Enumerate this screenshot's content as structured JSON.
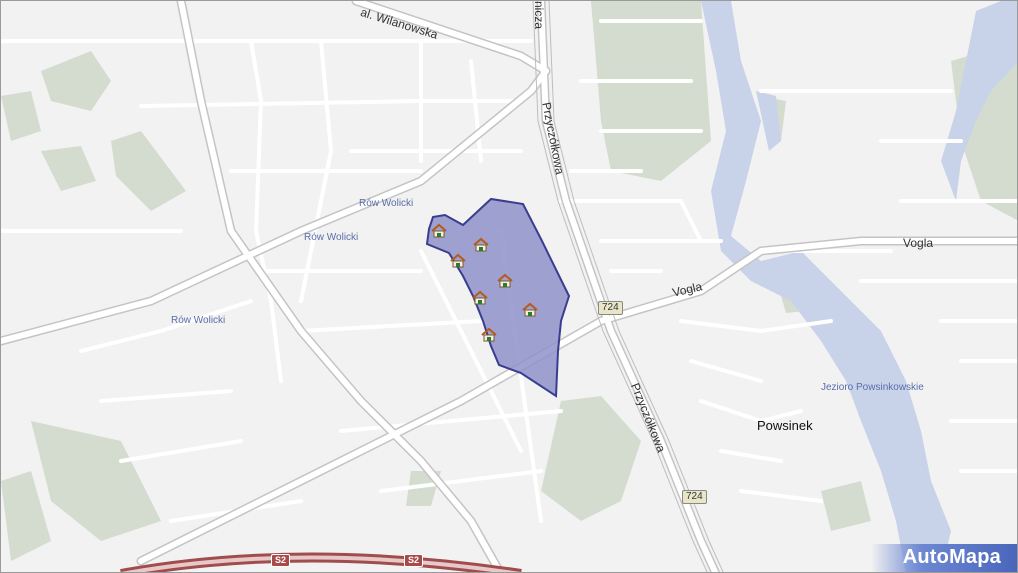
{
  "labels": {
    "wilanowska": "al. Wilanowska",
    "nicza": "nicza",
    "przyczolkowa_north": "Przyczółkowa",
    "przyczolkowa_south": "Przyczółkowa",
    "vogla_east": "Vogla",
    "vogla_mid": "Vogla",
    "row_wolicki_1": "Rów Wolicki",
    "row_wolicki_2": "Rów Wolicki",
    "row_wolicki_3": "Rów Wolicki",
    "jezioro": "Jezioro Powsinkowskie",
    "powsinek": "Powsinek"
  },
  "shields": {
    "r724_north": "724",
    "r724_south": "724",
    "s2_left": "S2",
    "s2_right": "S2"
  },
  "markers": {
    "count": 6,
    "icon": "house-icon"
  },
  "colors": {
    "area_fill": "#8f92c9",
    "area_stroke": "#3a3d8f",
    "water": "#c9d3ea",
    "green": "#d5ddd0",
    "road": "#ffffff",
    "background": "#f2f2f2"
  },
  "logo": {
    "text": "AutoMapa"
  }
}
